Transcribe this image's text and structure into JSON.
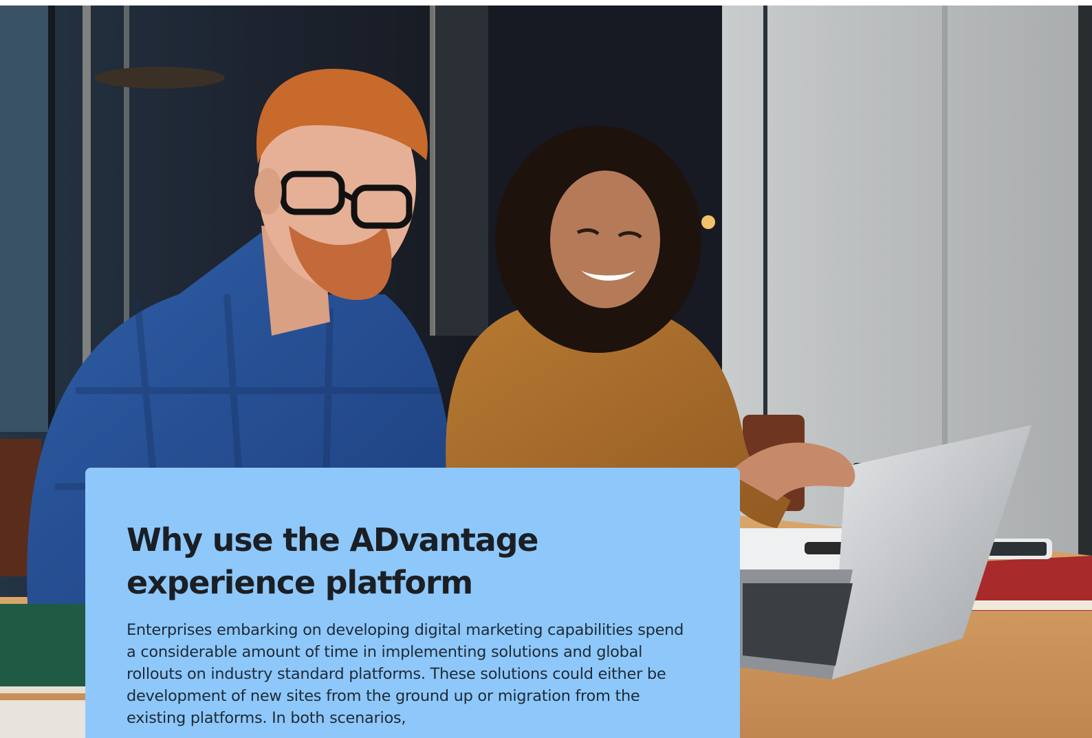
{
  "hero": {
    "image_icon": "photo-two-colleagues-laptop-icon"
  },
  "card": {
    "title": "Why use the ADvantage experience platform",
    "body": "Enterprises embarking on developing digital marketing capabilities spend a considerable amount of time in implementing solutions and global rollouts on industry standard platforms. These solutions could either be development of new sites from the ground up or migration from the existing platforms. In both scenarios,",
    "background_color": "#8ec8fb"
  }
}
